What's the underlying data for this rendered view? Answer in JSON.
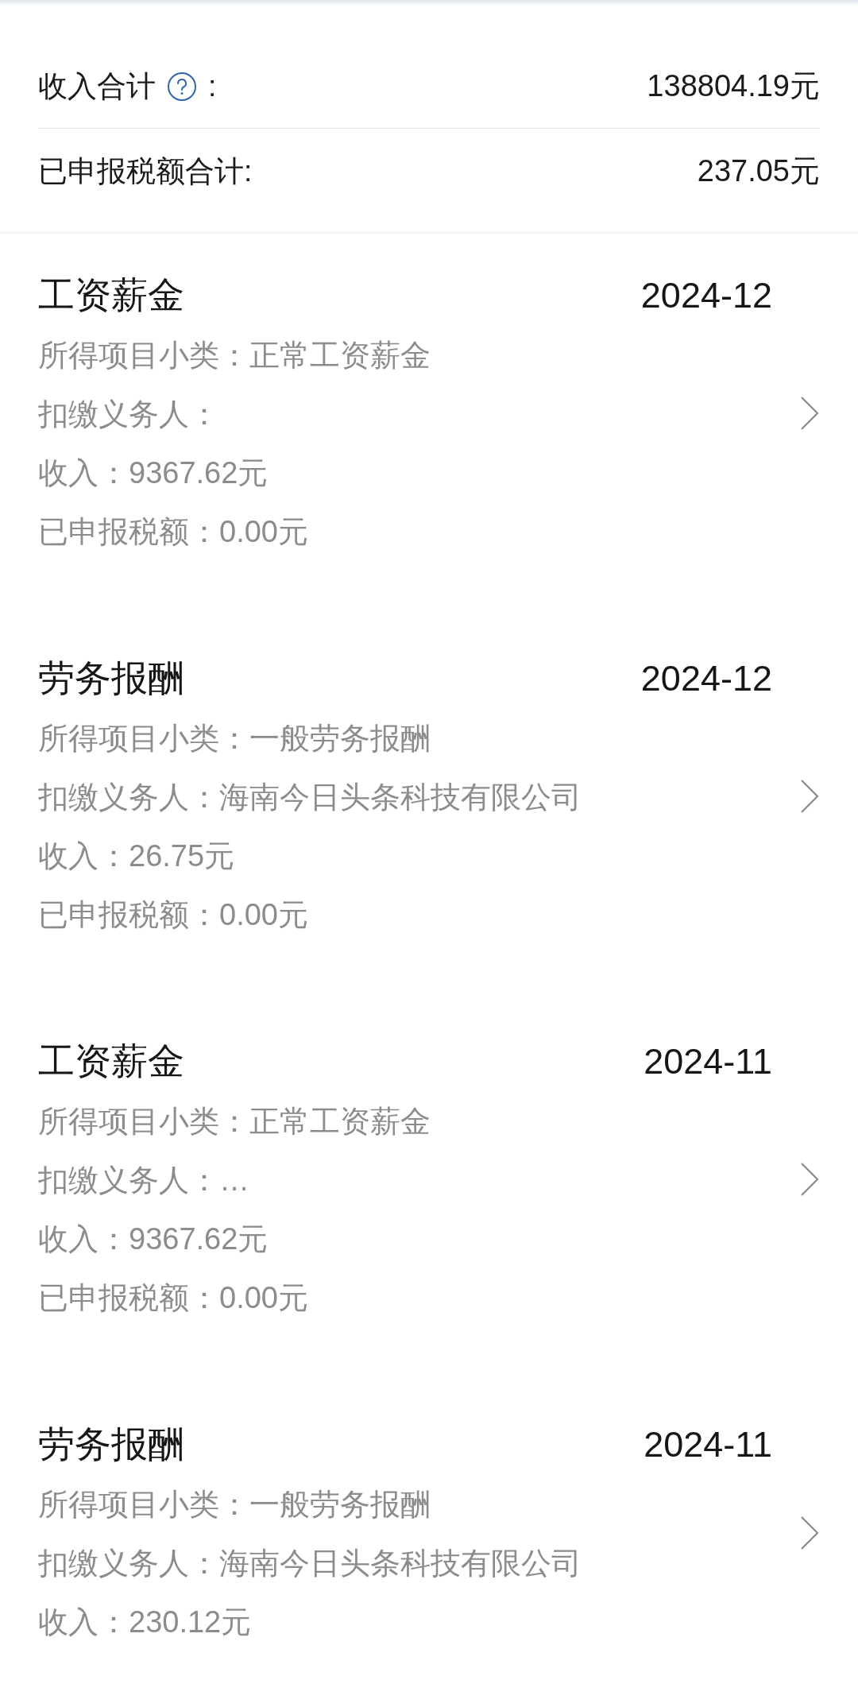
{
  "summary": {
    "income_label": "收入合计",
    "income_colon": ":",
    "income_value": "138804.19元",
    "tax_label": "已申报税额合计:",
    "tax_value": "237.05元"
  },
  "records": [
    {
      "category": "工资薪金",
      "period": "2024-12",
      "lines": [
        "所得项目小类：正常工资薪金",
        "扣缴义务人：",
        "收入：9367.62元",
        "已申报税额：0.00元"
      ]
    },
    {
      "category": "劳务报酬",
      "period": "2024-12",
      "lines": [
        "所得项目小类：一般劳务报酬",
        "扣缴义务人：海南今日头条科技有限公司",
        "收入：26.75元",
        "已申报税额：0.00元"
      ]
    },
    {
      "category": "工资薪金",
      "period": "2024-11",
      "lines": [
        "所得项目小类：正常工资薪金",
        "扣缴义务人：…",
        "收入：9367.62元",
        "已申报税额：0.00元"
      ]
    },
    {
      "category": "劳务报酬",
      "period": "2024-11",
      "lines": [
        "所得项目小类：一般劳务报酬",
        "扣缴义务人：海南今日头条科技有限公司",
        "收入：230.12元"
      ]
    }
  ]
}
